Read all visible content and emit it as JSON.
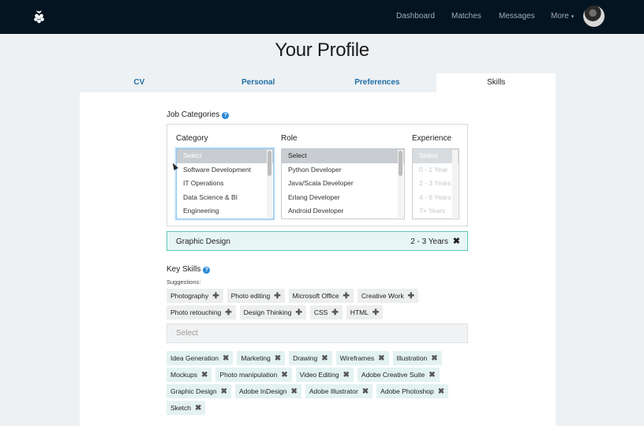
{
  "nav": {
    "links": [
      "Dashboard",
      "Matches",
      "Messages",
      "More"
    ],
    "more_caret": "▾"
  },
  "page": {
    "title": "Your Profile"
  },
  "tabs": [
    "CV",
    "Personal",
    "Preferences",
    "Skills"
  ],
  "job_categories": {
    "label": "Job Categories",
    "help": "?",
    "category": {
      "title": "Category",
      "options": [
        "Select",
        "Software Development",
        "IT Operations",
        "Data Science & BI",
        "Engineering"
      ]
    },
    "role": {
      "title": "Role",
      "options": [
        "Select",
        "Python Developer",
        "Java/Scala Developer",
        "Erlang Developer",
        "Android Developer"
      ]
    },
    "experience": {
      "title": "Experience",
      "options": [
        "Select",
        "0 - 1 Year",
        "2 - 3 Years",
        "4 - 6 Years",
        "7+ Years"
      ]
    },
    "selected": {
      "category": "Graphic Design",
      "experience": "2 - 3 Years",
      "remove": "✖"
    }
  },
  "key_skills": {
    "label": "Key Skills",
    "help": "?",
    "suggestions_label": "Suggestions:",
    "suggestions": [
      "Photography",
      "Photo editing",
      "Microsoft Office",
      "Creative Work",
      "Photo retouching",
      "Design Thinking",
      "CSS",
      "HTML"
    ],
    "add_symbol": "✚",
    "remove_symbol": "✖",
    "select_placeholder": "Select",
    "selected": [
      "Idea Generation",
      "Marketing",
      "Drawing",
      "Wireframes",
      "Illustration",
      "Mockups",
      "Photo manipulation",
      "Video Editing",
      "Adobe Creative Suite",
      "Graphic Design",
      "Adobe InDesign",
      "Adobe Illustrator",
      "Adobe Photoshop",
      "Sketch"
    ]
  },
  "colors": {
    "navbar": "#051421",
    "link_blue": "#1f6ea5",
    "help_blue": "#2b8ad6",
    "selected_border": "#5fc7b8",
    "selected_bg": "#e7f6f4"
  }
}
